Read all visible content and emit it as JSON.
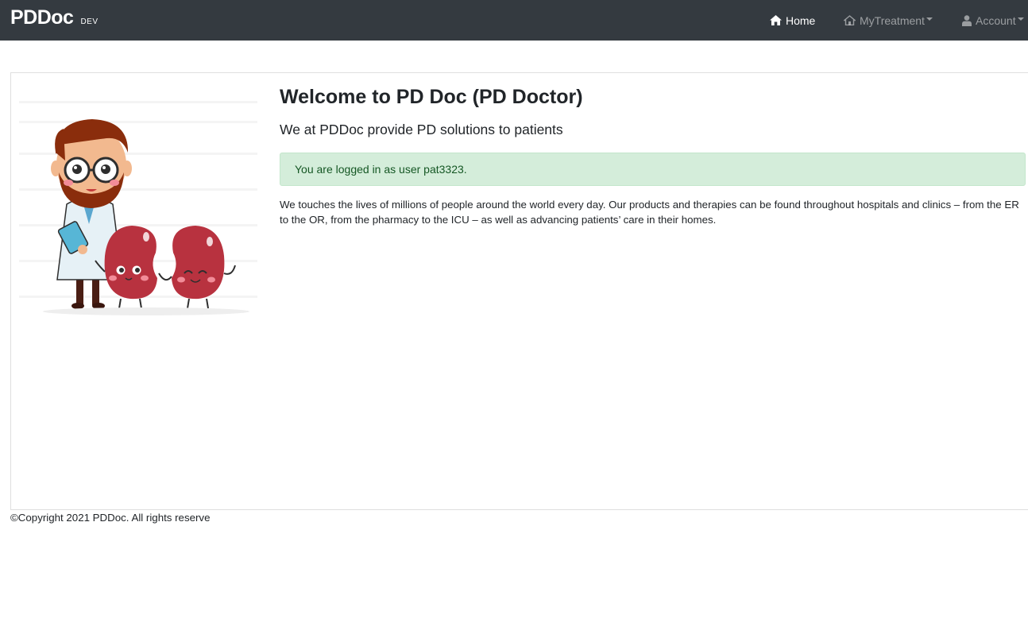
{
  "navbar": {
    "brand": "PDDoc",
    "env_badge": "DEV",
    "items": [
      {
        "label": "Home",
        "icon": "home-icon"
      },
      {
        "label": "MyTreatment",
        "icon": "house-outline-icon"
      },
      {
        "label": "Account",
        "icon": "user-icon"
      }
    ]
  },
  "main": {
    "title": "Welcome to PD Doc (PD Doctor)",
    "subtitle": "We at PDDoc provide PD solutions to patients",
    "alert": "You are logged in as user pat3323.",
    "body": "We touches the lives of millions of people around the world every day. Our products and therapies can be found throughout hospitals and clinics – from the ER to the OR, from the pharmacy to the ICU – as well as advancing patients’ care in their homes."
  },
  "footer": {
    "copyright": "©Copyright 2021 PDDoc. All rights reserve"
  },
  "colors": {
    "navbar_bg": "#343a40",
    "alert_bg": "#d4edda",
    "alert_text": "#155724",
    "kidney": "#b8323f"
  }
}
